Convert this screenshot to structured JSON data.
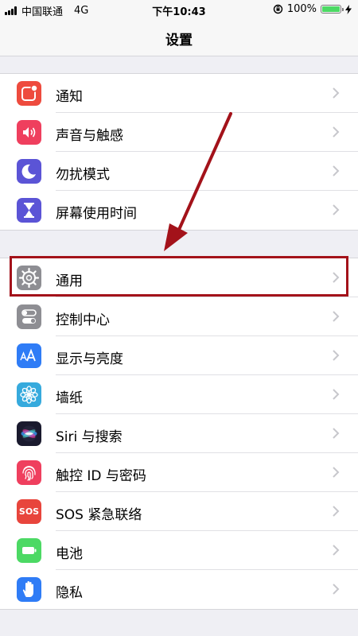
{
  "status_bar": {
    "carrier": "中国联通",
    "network": "4G",
    "time": "下午10:43",
    "battery_percent": "100%"
  },
  "nav": {
    "title": "设置"
  },
  "groups": [
    {
      "items": [
        {
          "label": "通知",
          "icon": "notifications-icon",
          "color": "#ee4b3e"
        },
        {
          "label": "声音与触感",
          "icon": "sounds-icon",
          "color": "#ef3f5e"
        },
        {
          "label": "勿扰模式",
          "icon": "do-not-disturb-icon",
          "color": "#5b54d6"
        },
        {
          "label": "屏幕使用时间",
          "icon": "screen-time-icon",
          "color": "#5b54d6"
        }
      ]
    },
    {
      "items": [
        {
          "label": "通用",
          "icon": "general-gear-icon",
          "color": "#8e8e93"
        },
        {
          "label": "控制中心",
          "icon": "control-center-icon",
          "color": "#8e8e93"
        },
        {
          "label": "显示与亮度",
          "icon": "display-brightness-icon",
          "color": "#2f7cf6"
        },
        {
          "label": "墙纸",
          "icon": "wallpaper-icon",
          "color": "#36aadd"
        },
        {
          "label": "Siri 与搜索",
          "icon": "siri-icon",
          "color": "#1a1a2e"
        },
        {
          "label": "触控 ID 与密码",
          "icon": "touch-id-icon",
          "color": "#ef3f5e"
        },
        {
          "label": "SOS 紧急联络",
          "icon": "sos-icon",
          "color": "#e8453c",
          "icon_text": "SOS"
        },
        {
          "label": "电池",
          "icon": "battery-icon",
          "color": "#4cd964"
        },
        {
          "label": "隐私",
          "icon": "privacy-hand-icon",
          "color": "#2f7cf6"
        }
      ]
    }
  ],
  "annotation": {
    "highlighted_item": "通用",
    "color": "#a3121a"
  }
}
